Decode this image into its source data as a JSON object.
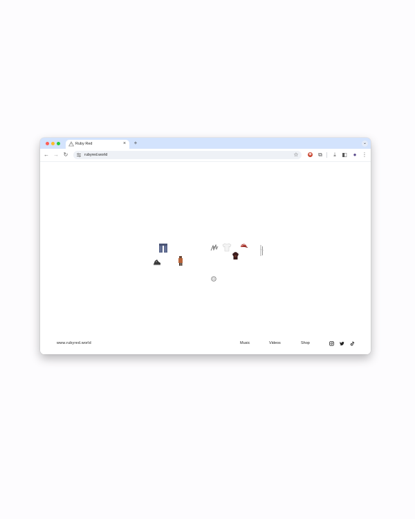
{
  "browser": {
    "tab": {
      "title": "Ruby Red",
      "favicon": "warning-triangle-icon",
      "close_glyph": "×"
    },
    "new_tab_glyph": "+",
    "tab_search_glyph": "⌄",
    "toolbar": {
      "back_glyph": "←",
      "forward_glyph": "→",
      "reload_glyph": "↻",
      "url": "rubyred.world",
      "bookmark_glyph": "☆",
      "extension_glyph": "◉",
      "puzzle_glyph": "⧉",
      "download_glyph": "⤓",
      "sidepanel_glyph": "◧",
      "profile_glyph": "●",
      "menu_glyph": "⋮"
    }
  },
  "page": {
    "footer": {
      "site": "www.rubyred.world",
      "links": [
        "Music",
        "Videos",
        "Shop"
      ],
      "social": [
        "instagram-icon",
        "twitter-icon",
        "tiktok-icon"
      ]
    }
  },
  "colors": {
    "tab_strip": "#d3e3fd",
    "omnibox": "#eef1f6",
    "close": "#fe5f57",
    "minimize": "#febc2e",
    "maximize": "#28c840"
  }
}
